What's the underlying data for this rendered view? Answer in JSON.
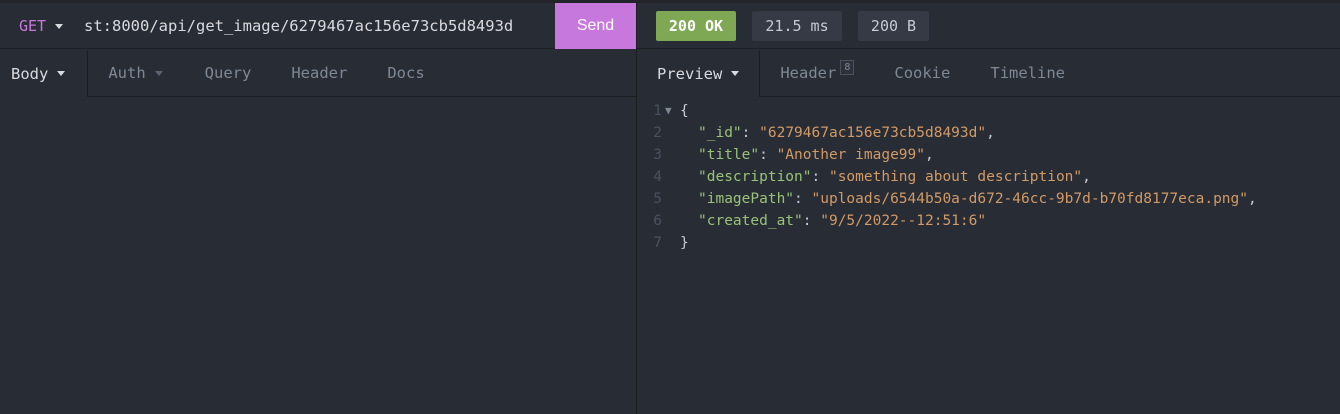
{
  "request": {
    "method": "GET",
    "url": "st:8000/api/get_image/6279467ac156e73cb5d8493d",
    "send_label": "Send"
  },
  "response": {
    "status": "200 OK",
    "time": "21.5 ms",
    "size": "200 B"
  },
  "request_tabs": [
    {
      "label": "Body"
    },
    {
      "label": "Auth"
    },
    {
      "label": "Query"
    },
    {
      "label": "Header"
    },
    {
      "label": "Docs"
    }
  ],
  "response_tabs": [
    {
      "label": "Preview"
    },
    {
      "label": "Header",
      "count": "8"
    },
    {
      "label": "Cookie"
    },
    {
      "label": "Timeline"
    }
  ],
  "preview": {
    "line_numbers": [
      "1",
      "2",
      "3",
      "4",
      "5",
      "6",
      "7"
    ],
    "open_brace": "{",
    "close_brace": "}",
    "fields": [
      {
        "key": "\"_id\"",
        "value": "\"6279467ac156e73cb5d8493d\"",
        "comma": ","
      },
      {
        "key": "\"title\"",
        "value": "\"Another image99\"",
        "comma": ","
      },
      {
        "key": "\"description\"",
        "value": "\"something about description\"",
        "comma": ","
      },
      {
        "key": "\"imagePath\"",
        "value": "\"uploads/6544b50a-d672-46cc-9b7d-b70fd8177eca.png\"",
        "comma": ","
      },
      {
        "key": "\"created_at\"",
        "value": "\"9/5/2022--12:51:6\"",
        "comma": ""
      }
    ]
  },
  "colors": {
    "background": "#282c34",
    "accent": "#c678dd",
    "status_ok": "#7fa855",
    "json_key": "#98c379",
    "json_string": "#d19a66"
  }
}
